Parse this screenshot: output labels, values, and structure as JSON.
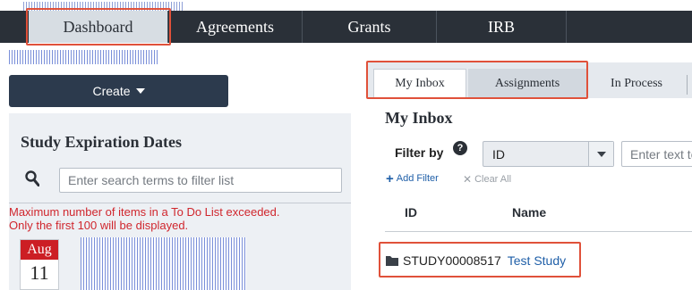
{
  "nav": {
    "tabs": [
      {
        "label": "Dashboard",
        "active": true
      },
      {
        "label": "Agreements",
        "active": false
      },
      {
        "label": "Grants",
        "active": false
      },
      {
        "label": "IRB",
        "active": false
      }
    ]
  },
  "sidebar": {
    "create_label": "Create",
    "panel_title": "Study Expiration Dates",
    "search_placeholder": "Enter search terms to filter list",
    "warning_line1": "Maximum number of items in a To Do List exceeded.",
    "warning_line2": "Only the first 100 will be displayed.",
    "calendar": {
      "month": "Aug",
      "day": "11"
    }
  },
  "main": {
    "tabs": [
      {
        "label": "My Inbox",
        "active": true
      },
      {
        "label": "Assignments",
        "active": false
      },
      {
        "label": "In Process",
        "active": false
      }
    ],
    "title": "My Inbox",
    "filter_label": "Filter by",
    "filter_select_value": "ID",
    "filter_text_placeholder": "Enter text to search for",
    "add_filter": "Add Filter",
    "clear_all": "Clear All",
    "columns": [
      "ID",
      "Name"
    ],
    "rows": [
      {
        "id": "STUDY00008517",
        "name": "Test Study"
      }
    ]
  },
  "colors": {
    "nav_bg": "#2a3038",
    "highlight": "#e0513a",
    "link": "#1f5fa8",
    "warning": "#d0262d",
    "create_bg": "#2c3a4d"
  }
}
